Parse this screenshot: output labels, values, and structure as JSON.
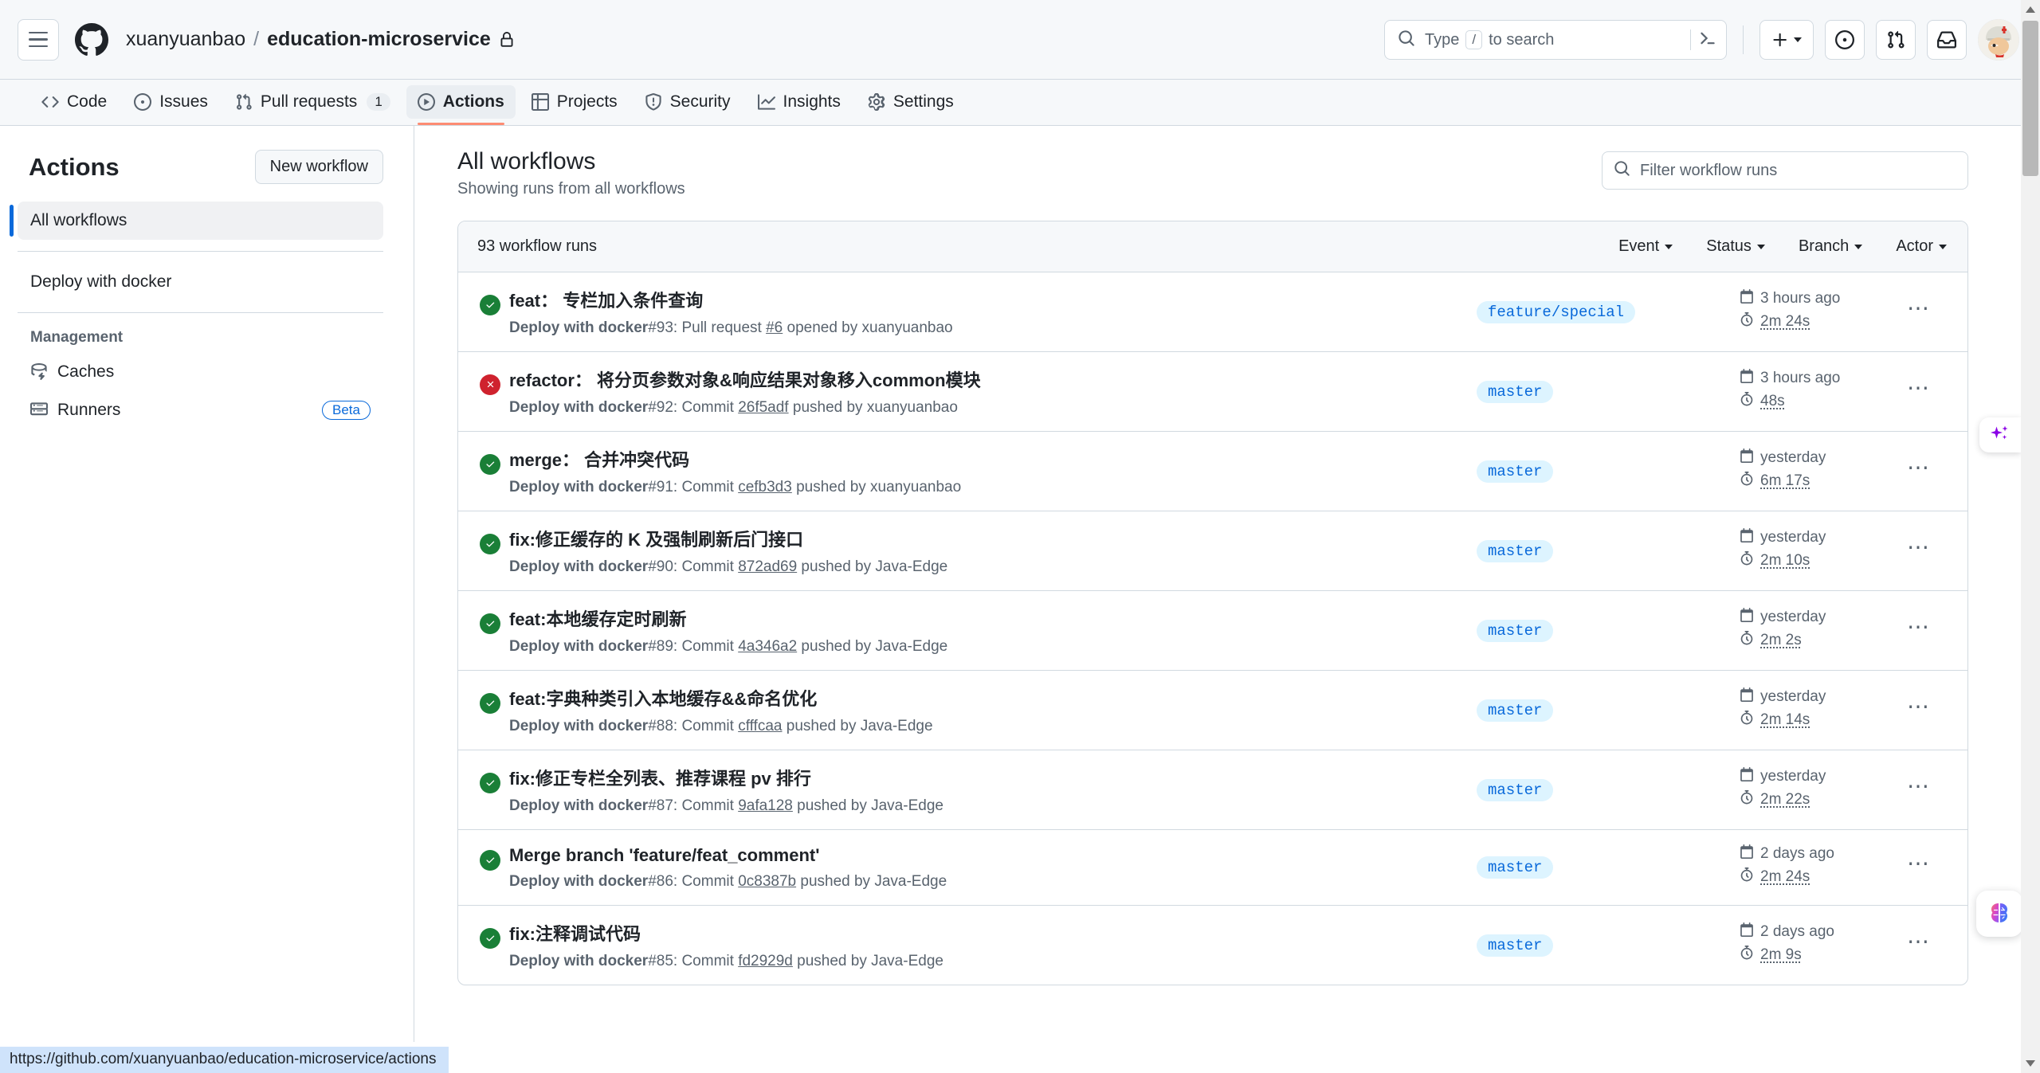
{
  "header": {
    "menu_icon": "hamburger-icon",
    "logo_icon": "github-logo-icon",
    "owner": "xuanyuanbao",
    "separator": "/",
    "repo": "education-microservice",
    "visibility_icon": "lock-icon",
    "search_placeholder": "Type  to search",
    "search_key_hint": "/",
    "terminal_icon": "command-palette-icon",
    "create_new_label": "+",
    "issues_icon": "issue-opened-icon",
    "pull_requests_icon": "git-pull-request-icon",
    "inbox_icon": "inbox-icon",
    "avatar_label": "avatar"
  },
  "repo_nav": {
    "items": [
      {
        "label": "Code",
        "icon": "code-icon",
        "active": false,
        "count": ""
      },
      {
        "label": "Issues",
        "icon": "issue-opened-icon",
        "active": false,
        "count": ""
      },
      {
        "label": "Pull requests",
        "icon": "git-pull-request-icon",
        "active": false,
        "count": "1"
      },
      {
        "label": "Actions",
        "icon": "play-circle-icon",
        "active": true,
        "count": ""
      },
      {
        "label": "Projects",
        "icon": "table-icon",
        "active": false,
        "count": ""
      },
      {
        "label": "Security",
        "icon": "shield-icon",
        "active": false,
        "count": ""
      },
      {
        "label": "Insights",
        "icon": "graph-icon",
        "active": false,
        "count": ""
      },
      {
        "label": "Settings",
        "icon": "gear-icon",
        "active": false,
        "count": ""
      }
    ]
  },
  "sidebar": {
    "title": "Actions",
    "new_workflow_label": "New workflow",
    "all_workflows_label": "All workflows",
    "workflows": [
      {
        "label": "Deploy with docker"
      }
    ],
    "management_title": "Management",
    "management_items": [
      {
        "label": "Caches",
        "icon": "cache-icon",
        "badge": ""
      },
      {
        "label": "Runners",
        "icon": "server-icon",
        "badge": "Beta"
      }
    ]
  },
  "main": {
    "title": "All workflows",
    "subtitle": "Showing runs from all workflows",
    "filter_placeholder": "Filter workflow runs",
    "search_icon": "search-icon",
    "runs_count_label": "93 workflow runs",
    "filters": [
      {
        "label": "Event"
      },
      {
        "label": "Status"
      },
      {
        "label": "Branch"
      },
      {
        "label": "Actor"
      }
    ],
    "runs": [
      {
        "status": "success",
        "title": "feat： 专栏加入条件查询",
        "workflow": "Deploy with docker",
        "run_number": "#93",
        "meta_prefix": ": Pull request ",
        "link": "#6",
        "meta_suffix": " opened by xuanyuanbao",
        "branch": "feature/special",
        "time": "3 hours ago",
        "duration": "2m 24s"
      },
      {
        "status": "failure",
        "title": "refactor： 将分页参数对象&响应结果对象移入common模块",
        "workflow": "Deploy with docker",
        "run_number": "#92",
        "meta_prefix": ": Commit ",
        "link": "26f5adf",
        "meta_suffix": " pushed by xuanyuanbao",
        "branch": "master",
        "time": "3 hours ago",
        "duration": "48s"
      },
      {
        "status": "success",
        "title": "merge： 合并冲突代码",
        "workflow": "Deploy with docker",
        "run_number": "#91",
        "meta_prefix": ": Commit ",
        "link": "cefb3d3",
        "meta_suffix": " pushed by xuanyuanbao",
        "branch": "master",
        "time": "yesterday",
        "duration": "6m 17s"
      },
      {
        "status": "success",
        "title": "fix:修正缓存的 K 及强制刷新后门接口",
        "workflow": "Deploy with docker",
        "run_number": "#90",
        "meta_prefix": ": Commit ",
        "link": "872ad69",
        "meta_suffix": " pushed by Java-Edge",
        "branch": "master",
        "time": "yesterday",
        "duration": "2m 10s"
      },
      {
        "status": "success",
        "title": "feat:本地缓存定时刷新",
        "workflow": "Deploy with docker",
        "run_number": "#89",
        "meta_prefix": ": Commit ",
        "link": "4a346a2",
        "meta_suffix": " pushed by Java-Edge",
        "branch": "master",
        "time": "yesterday",
        "duration": "2m 2s"
      },
      {
        "status": "success",
        "title": "feat:字典种类引入本地缓存&&命名优化",
        "workflow": "Deploy with docker",
        "run_number": "#88",
        "meta_prefix": ": Commit ",
        "link": "cfffcaa",
        "meta_suffix": " pushed by Java-Edge",
        "branch": "master",
        "time": "yesterday",
        "duration": "2m 14s"
      },
      {
        "status": "success",
        "title": "fix:修正专栏全列表、推荐课程 pv 排行",
        "workflow": "Deploy with docker",
        "run_number": "#87",
        "meta_prefix": ": Commit ",
        "link": "9afa128",
        "meta_suffix": " pushed by Java-Edge",
        "branch": "master",
        "time": "yesterday",
        "duration": "2m 22s"
      },
      {
        "status": "success",
        "title": "Merge branch 'feature/feat_comment'",
        "workflow": "Deploy with docker",
        "run_number": "#86",
        "meta_prefix": ": Commit ",
        "link": "0c8387b",
        "meta_suffix": " pushed by Java-Edge",
        "branch": "master",
        "time": "2 days ago",
        "duration": "2m 24s"
      },
      {
        "status": "success",
        "title": "fix:注释调试代码",
        "workflow": "Deploy with docker",
        "run_number": "#85",
        "meta_prefix": ": Commit ",
        "link": "fd2929d",
        "meta_suffix": " pushed by Java-Edge",
        "branch": "master",
        "time": "2 days ago",
        "duration": "2m 9s"
      }
    ]
  },
  "floating": {
    "sparkle_icon": "copilot-sparkle-icon",
    "brain_icon": "ai-brain-icon"
  },
  "status_bar": {
    "url": "https://github.com/xuanyuanbao/education-microservice/actions"
  },
  "colors": {
    "accent": "#0969da",
    "success": "#1a7f37",
    "failure": "#cf222e",
    "branch_pill_bg": "#ddf4ff",
    "active_tab_underline": "#fd8c73"
  }
}
